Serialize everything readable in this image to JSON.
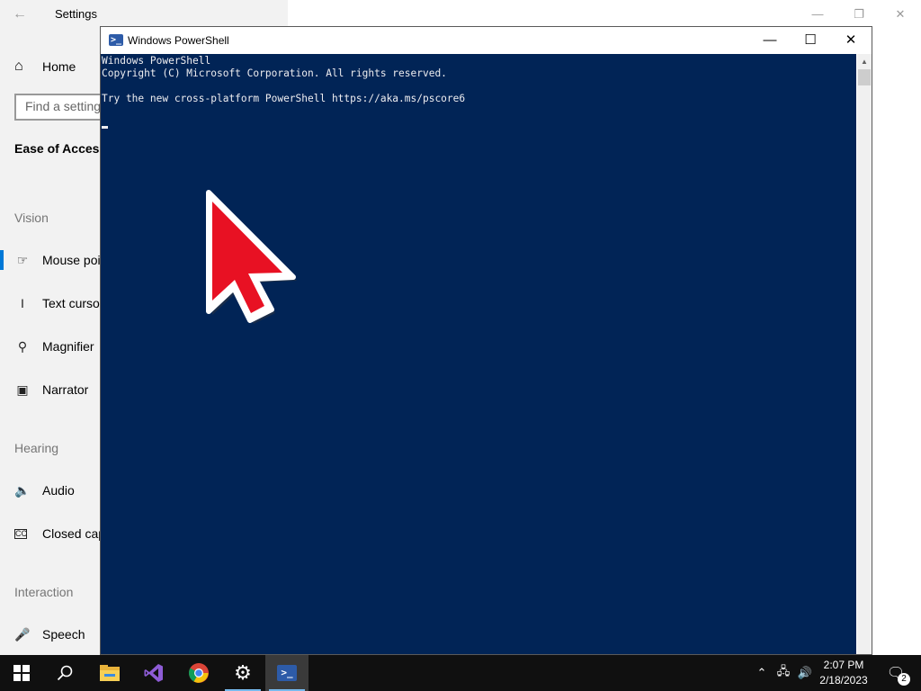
{
  "settings": {
    "title": "Settings",
    "home": "Home",
    "search_placeholder": "Find a setting",
    "section": "Ease of Access",
    "groups": [
      {
        "label": "Vision",
        "items": [
          "Mouse pointer",
          "Text cursor",
          "Magnifier",
          "Narrator"
        ]
      },
      {
        "label": "Hearing",
        "items": [
          "Audio",
          "Closed captions"
        ]
      },
      {
        "label": "Interaction",
        "items": [
          "Speech"
        ]
      }
    ]
  },
  "powershell": {
    "title": "Windows PowerShell",
    "lines": [
      "Windows PowerShell",
      "Copyright (C) Microsoft Corporation. All rights reserved.",
      "",
      "Try the new cross-platform PowerShell https://aka.ms/pscore6"
    ]
  },
  "taskbar": {
    "time": "2:07 PM",
    "date": "2/18/2023",
    "notification_count": "2",
    "pinned": [
      "start-icon",
      "search-icon",
      "file-explorer-icon",
      "visual-studio-icon",
      "chrome-icon",
      "settings-gear-icon",
      "powershell-icon"
    ]
  },
  "colors": {
    "console_bg": "#012456",
    "console_fg": "#eeedf0",
    "accent": "#0078d7",
    "pointer": "#e81123"
  }
}
